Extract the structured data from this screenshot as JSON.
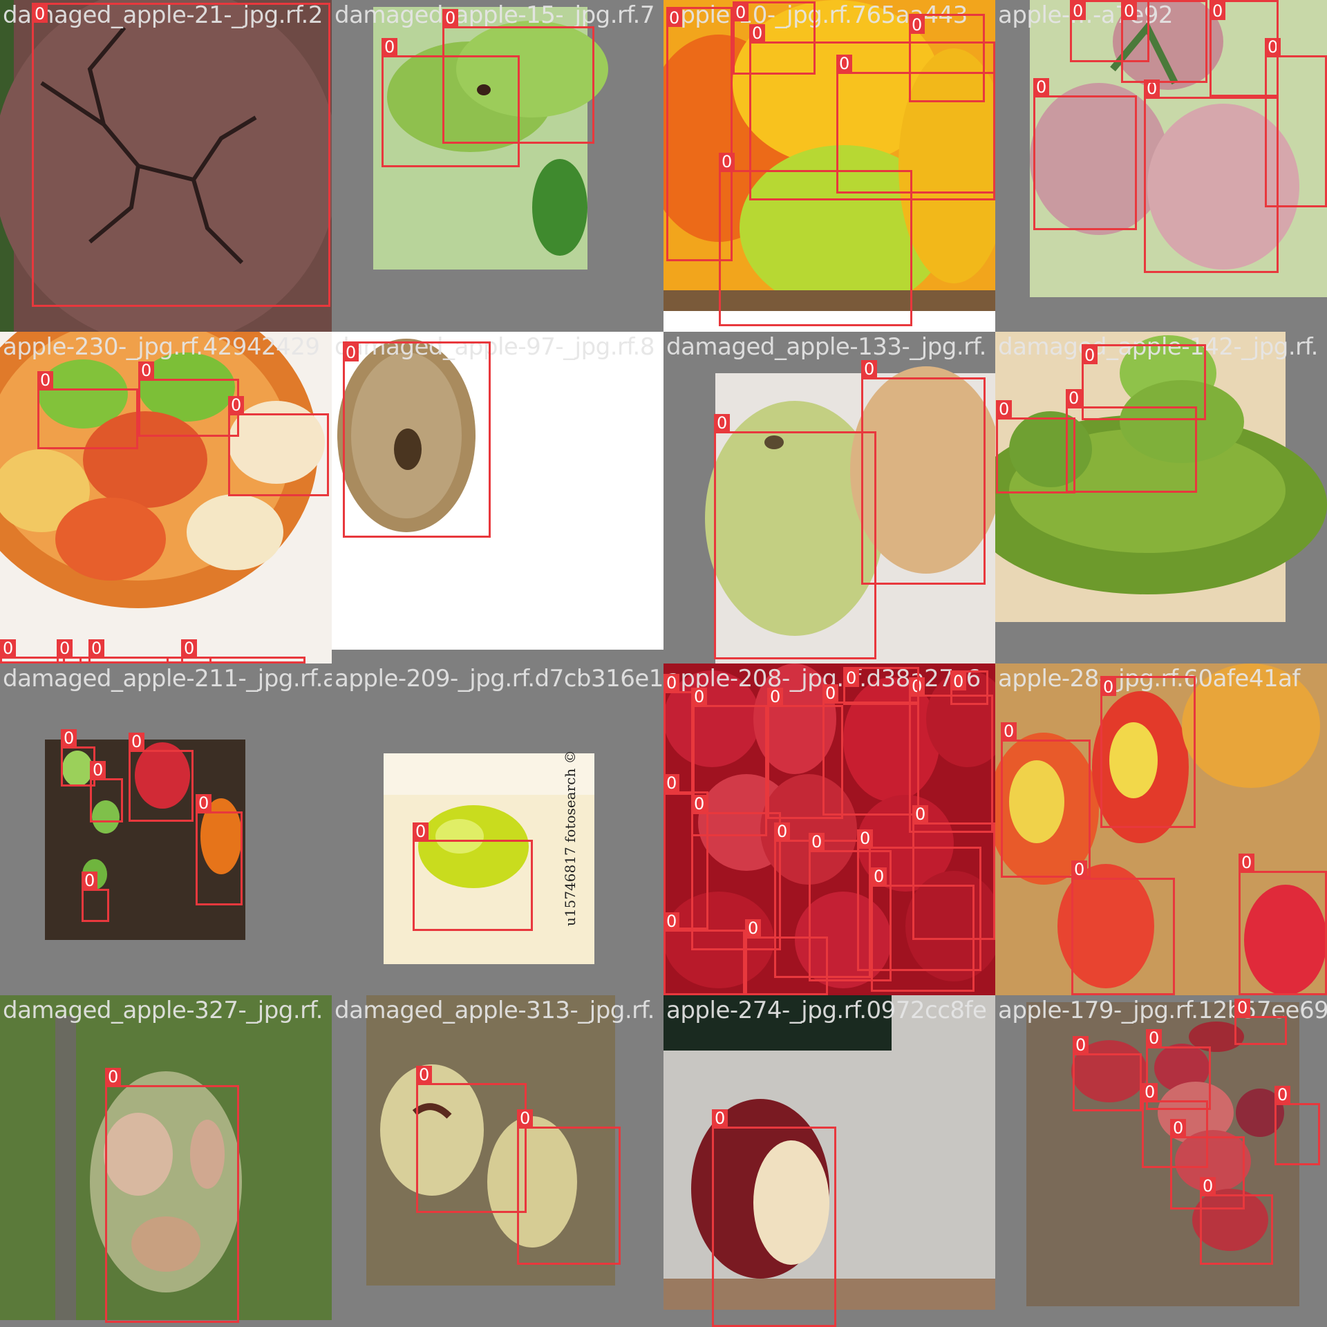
{
  "image": {
    "description_visible": "grid of 16 apple photos with red detection boxes labeled 0",
    "box_color": "#e8383d"
  },
  "tiles": [
    {
      "filename": "damaged_apple-21-_jpg.rf.2",
      "boxes": [
        {
          "label": "0"
        }
      ]
    },
    {
      "filename": "damaged_apple-15-_jpg.rf.7",
      "boxes": [
        {
          "label": "0"
        },
        {
          "label": "0"
        }
      ]
    },
    {
      "filename": "apple-10-_jpg.rf.765aa443",
      "boxes": [
        {
          "label": "0"
        },
        {
          "label": "0"
        },
        {
          "label": "0"
        },
        {
          "label": "0"
        },
        {
          "label": "0"
        },
        {
          "label": "0"
        }
      ]
    },
    {
      "filename": "apple-…-a7e92",
      "boxes": [
        {
          "label": "0"
        },
        {
          "label": "0"
        },
        {
          "label": "0"
        },
        {
          "label": "0"
        },
        {
          "label": "0"
        },
        {
          "label": "0"
        }
      ]
    },
    {
      "filename": "apple-230-_jpg.rf.42942429",
      "boxes": [
        {
          "label": "0"
        },
        {
          "label": "0"
        },
        {
          "label": "0"
        },
        {
          "label": "0"
        },
        {
          "label": "0"
        },
        {
          "label": "0"
        },
        {
          "label": "0"
        },
        {
          "label": "0"
        }
      ]
    },
    {
      "filename": "damaged_apple-97-_jpg.rf.8",
      "boxes": [
        {
          "label": "0"
        }
      ]
    },
    {
      "filename": "damaged_apple-133-_jpg.rf.",
      "boxes": [
        {
          "label": "0"
        },
        {
          "label": "0"
        }
      ]
    },
    {
      "filename": "damaged_apple-142-_jpg.rf.",
      "boxes": [
        {
          "label": "0"
        },
        {
          "label": "0"
        },
        {
          "label": "0"
        }
      ]
    },
    {
      "filename": "damaged_apple-211-_jpg.rf.a0d8c2329",
      "boxes": [
        {
          "label": "0"
        },
        {
          "label": "0"
        },
        {
          "label": "0"
        },
        {
          "label": "0"
        },
        {
          "label": "0"
        }
      ]
    },
    {
      "filename": "apple-209-_jpg.rf.d7cb316e1",
      "boxes": [
        {
          "label": "0"
        }
      ]
    },
    {
      "filename": "apple-208-_jpg.rf.d38a27c6",
      "boxes": [
        {
          "label": "0"
        },
        {
          "label": "0"
        },
        {
          "label": "0"
        },
        {
          "label": "0"
        },
        {
          "label": "0"
        },
        {
          "label": "0"
        },
        {
          "label": "0"
        },
        {
          "label": "0"
        },
        {
          "label": "0"
        },
        {
          "label": "0"
        },
        {
          "label": "0"
        },
        {
          "label": "0"
        },
        {
          "label": "0"
        },
        {
          "label": "0"
        },
        {
          "label": "0"
        },
        {
          "label": "0"
        }
      ]
    },
    {
      "filename": "apple-28-_jpg.rf.60afe41af",
      "boxes": [
        {
          "label": "0"
        },
        {
          "label": "0"
        },
        {
          "label": "0"
        },
        {
          "label": "0"
        }
      ]
    },
    {
      "filename": "damaged_apple-327-_jpg.rf.",
      "boxes": [
        {
          "label": "0"
        }
      ]
    },
    {
      "filename": "damaged_apple-313-_jpg.rf.",
      "boxes": [
        {
          "label": "0"
        },
        {
          "label": "0"
        }
      ]
    },
    {
      "filename": "apple-274-_jpg.rf.0972cc8fe",
      "boxes": [
        {
          "label": "0"
        }
      ]
    },
    {
      "filename": "apple-179-_jpg.rf.12b57ee69",
      "boxes": [
        {
          "label": "0"
        },
        {
          "label": "0"
        },
        {
          "label": "0"
        },
        {
          "label": "0"
        },
        {
          "label": "0"
        },
        {
          "label": "0"
        },
        {
          "label": "0"
        }
      ]
    }
  ]
}
